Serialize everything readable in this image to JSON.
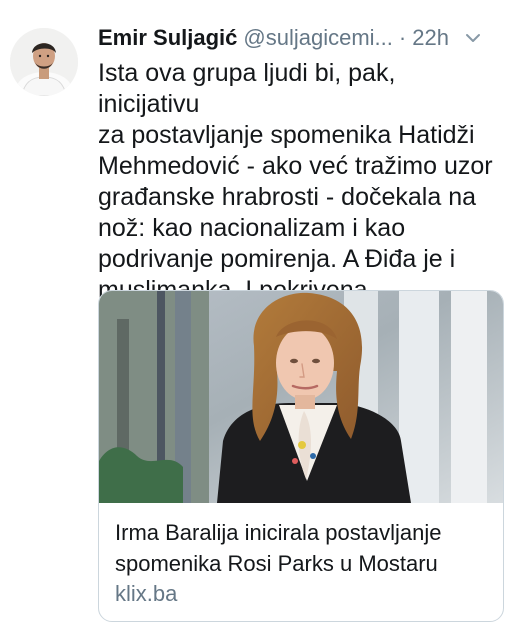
{
  "tweet": {
    "author": {
      "display_name": "Emir Suljagić",
      "handle": "@suljagicemi...",
      "avatar_icon": "profile-photo"
    },
    "separator": "·",
    "timestamp": "22h",
    "menu_icon": "chevron-down-icon",
    "text_lines": [
      "Ista ova grupa ljudi bi, pak, inicijativu",
      "za postavljanje spomenika Hatidži",
      "Mehmedović - ako već tražimo uzor",
      "građanske hrabrosti - dočekala na",
      "nož: kao nacionalizam i kao",
      "podrivanje pomirenja. A Điđa je i",
      "muslimanka. I pokrivena."
    ]
  },
  "link_card": {
    "image_icon": "article-photo",
    "title_lines": [
      "Irma Baralija inicirala postavljanje",
      "spomenika Rosi Parks u Mostaru"
    ],
    "domain": "klix.ba"
  },
  "colors": {
    "primary_text": "#14171a",
    "secondary_text": "#657786",
    "border": "#ccd6dd",
    "background": "#ffffff"
  }
}
